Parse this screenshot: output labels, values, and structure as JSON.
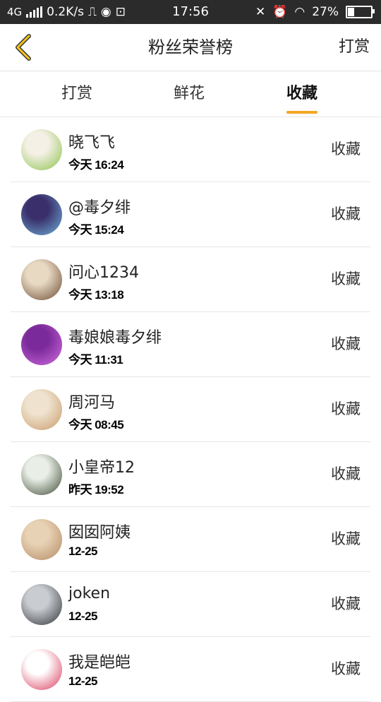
{
  "status_bar": {
    "network": "4G",
    "speed": "0.2K/s",
    "time": "17:56",
    "battery": "27%",
    "battery_level": 0.27
  },
  "header": {
    "title": "粉丝荣誉榜",
    "right_action": "打赏"
  },
  "tabs": [
    {
      "label": "打赏",
      "active": false
    },
    {
      "label": "鲜花",
      "active": false
    },
    {
      "label": "收藏",
      "active": true
    }
  ],
  "fans": [
    {
      "name": "晓飞飞",
      "time": "今天 16:24",
      "action": "收藏",
      "avatar_colors": [
        "#f5f0e6",
        "#8bc34a"
      ]
    },
    {
      "name": "@毒夕绯",
      "time": "今天 15:24",
      "action": "收藏",
      "avatar_colors": [
        "#3a2f6b",
        "#6fb3d9"
      ]
    },
    {
      "name": "问心1234",
      "time": "今天 13:18",
      "action": "收藏",
      "avatar_colors": [
        "#e8d9c2",
        "#6b4a33"
      ]
    },
    {
      "name": "毒娘娘毒夕绯",
      "time": "今天 11:31",
      "action": "收藏",
      "avatar_colors": [
        "#7a2a9a",
        "#d36ce0"
      ]
    },
    {
      "name": "周河马",
      "time": "今天 08:45",
      "action": "收藏",
      "avatar_colors": [
        "#efe3cf",
        "#c99a6a"
      ]
    },
    {
      "name": "小皇帝12",
      "time": "昨天 19:52",
      "action": "收藏",
      "avatar_colors": [
        "#e9eee6",
        "#3d4a36"
      ]
    },
    {
      "name": "囡囡阿姨",
      "time": "12-25",
      "action": "收藏",
      "avatar_colors": [
        "#e8d2b5",
        "#b38a63"
      ]
    },
    {
      "name": "joken",
      "time": "12-25",
      "action": "收藏",
      "avatar_colors": [
        "#c9ccd1",
        "#2f3236"
      ]
    },
    {
      "name": "我是皑皑",
      "time": "12-25",
      "action": "收藏",
      "avatar_colors": [
        "#ffffff",
        "#d83a5a"
      ]
    }
  ],
  "icons": {
    "back": "chevron-left-icon",
    "accent": "#f5a623"
  }
}
